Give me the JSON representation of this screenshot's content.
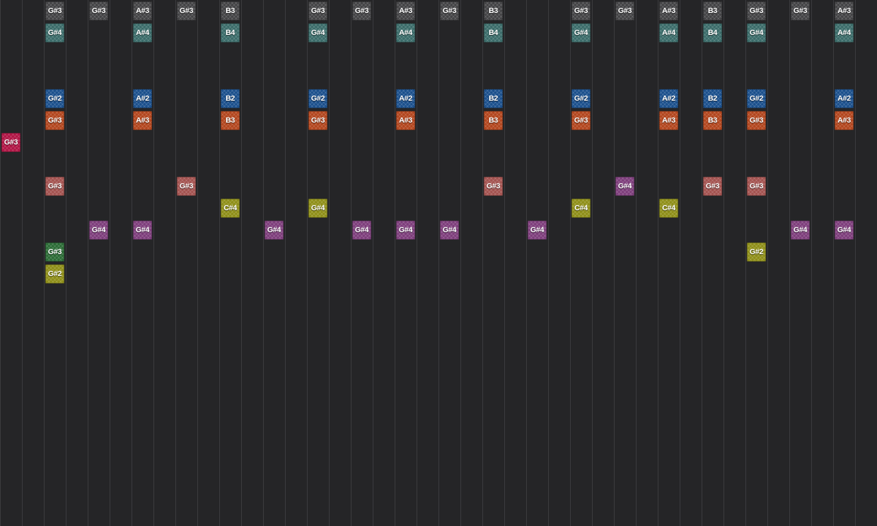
{
  "palette": {
    "background": "#252527",
    "gridline": "#3c3c3f",
    "gray": "#424244",
    "teal": "#3a6b69",
    "blue": "#1a4f8c",
    "orange": "#b2451d",
    "crimson": "#b01444",
    "salmon": "#a3524f",
    "olive": "#8e8e17",
    "purple": "#7d3d7b",
    "green": "#2b6b35",
    "yellow": "#8e8e17"
  },
  "notes": [
    {
      "col": 2,
      "row": 0,
      "label": "G#3",
      "color": "gray"
    },
    {
      "col": 4,
      "row": 0,
      "label": "G#3",
      "color": "gray"
    },
    {
      "col": 6,
      "row": 0,
      "label": "A#3",
      "color": "gray"
    },
    {
      "col": 8,
      "row": 0,
      "label": "G#3",
      "color": "gray"
    },
    {
      "col": 10,
      "row": 0,
      "label": "B3",
      "color": "gray"
    },
    {
      "col": 14,
      "row": 0,
      "label": "G#3",
      "color": "gray"
    },
    {
      "col": 16,
      "row": 0,
      "label": "G#3",
      "color": "gray"
    },
    {
      "col": 18,
      "row": 0,
      "label": "A#3",
      "color": "gray"
    },
    {
      "col": 20,
      "row": 0,
      "label": "G#3",
      "color": "gray"
    },
    {
      "col": 22,
      "row": 0,
      "label": "B3",
      "color": "gray"
    },
    {
      "col": 26,
      "row": 0,
      "label": "G#3",
      "color": "gray"
    },
    {
      "col": 28,
      "row": 0,
      "label": "G#3",
      "color": "gray"
    },
    {
      "col": 30,
      "row": 0,
      "label": "A#3",
      "color": "gray"
    },
    {
      "col": 32,
      "row": 0,
      "label": "B3",
      "color": "gray"
    },
    {
      "col": 34,
      "row": 0,
      "label": "G#3",
      "color": "gray"
    },
    {
      "col": 36,
      "row": 0,
      "label": "G#3",
      "color": "gray"
    },
    {
      "col": 38,
      "row": 0,
      "label": "A#3",
      "color": "gray"
    },
    {
      "col": 2,
      "row": 1,
      "label": "G#4",
      "color": "teal"
    },
    {
      "col": 6,
      "row": 1,
      "label": "A#4",
      "color": "teal"
    },
    {
      "col": 10,
      "row": 1,
      "label": "B4",
      "color": "teal"
    },
    {
      "col": 14,
      "row": 1,
      "label": "G#4",
      "color": "teal"
    },
    {
      "col": 18,
      "row": 1,
      "label": "A#4",
      "color": "teal"
    },
    {
      "col": 22,
      "row": 1,
      "label": "B4",
      "color": "teal"
    },
    {
      "col": 26,
      "row": 1,
      "label": "G#4",
      "color": "teal"
    },
    {
      "col": 30,
      "row": 1,
      "label": "A#4",
      "color": "teal"
    },
    {
      "col": 32,
      "row": 1,
      "label": "B4",
      "color": "teal"
    },
    {
      "col": 34,
      "row": 1,
      "label": "G#4",
      "color": "teal"
    },
    {
      "col": 38,
      "row": 1,
      "label": "A#4",
      "color": "teal"
    },
    {
      "col": 2,
      "row": 4,
      "label": "G#2",
      "color": "blue"
    },
    {
      "col": 6,
      "row": 4,
      "label": "A#2",
      "color": "blue"
    },
    {
      "col": 10,
      "row": 4,
      "label": "B2",
      "color": "blue"
    },
    {
      "col": 14,
      "row": 4,
      "label": "G#2",
      "color": "blue"
    },
    {
      "col": 18,
      "row": 4,
      "label": "A#2",
      "color": "blue"
    },
    {
      "col": 22,
      "row": 4,
      "label": "B2",
      "color": "blue"
    },
    {
      "col": 26,
      "row": 4,
      "label": "G#2",
      "color": "blue"
    },
    {
      "col": 30,
      "row": 4,
      "label": "A#2",
      "color": "blue"
    },
    {
      "col": 32,
      "row": 4,
      "label": "B2",
      "color": "blue"
    },
    {
      "col": 34,
      "row": 4,
      "label": "G#2",
      "color": "blue"
    },
    {
      "col": 38,
      "row": 4,
      "label": "A#2",
      "color": "blue"
    },
    {
      "col": 2,
      "row": 5,
      "label": "G#3",
      "color": "orange"
    },
    {
      "col": 6,
      "row": 5,
      "label": "A#3",
      "color": "orange"
    },
    {
      "col": 10,
      "row": 5,
      "label": "B3",
      "color": "orange"
    },
    {
      "col": 14,
      "row": 5,
      "label": "G#3",
      "color": "orange"
    },
    {
      "col": 18,
      "row": 5,
      "label": "A#3",
      "color": "orange"
    },
    {
      "col": 22,
      "row": 5,
      "label": "B3",
      "color": "orange"
    },
    {
      "col": 26,
      "row": 5,
      "label": "G#3",
      "color": "orange"
    },
    {
      "col": 30,
      "row": 5,
      "label": "A#3",
      "color": "orange"
    },
    {
      "col": 32,
      "row": 5,
      "label": "B3",
      "color": "orange"
    },
    {
      "col": 34,
      "row": 5,
      "label": "G#3",
      "color": "orange"
    },
    {
      "col": 38,
      "row": 5,
      "label": "A#3",
      "color": "orange"
    },
    {
      "col": 0,
      "row": 6,
      "label": "G#3",
      "color": "crimson"
    },
    {
      "col": 2,
      "row": 8,
      "label": "G#3",
      "color": "salmon"
    },
    {
      "col": 8,
      "row": 8,
      "label": "G#3",
      "color": "salmon"
    },
    {
      "col": 22,
      "row": 8,
      "label": "G#3",
      "color": "salmon"
    },
    {
      "col": 28,
      "row": 8,
      "label": "G#4",
      "color": "purple"
    },
    {
      "col": 32,
      "row": 8,
      "label": "G#3",
      "color": "salmon"
    },
    {
      "col": 34,
      "row": 8,
      "label": "G#3",
      "color": "salmon"
    },
    {
      "col": 10,
      "row": 9,
      "label": "C#4",
      "color": "olive"
    },
    {
      "col": 14,
      "row": 9,
      "label": "G#4",
      "color": "olive"
    },
    {
      "col": 26,
      "row": 9,
      "label": "C#4",
      "color": "olive"
    },
    {
      "col": 30,
      "row": 9,
      "label": "C#4",
      "color": "olive"
    },
    {
      "col": 4,
      "row": 10,
      "label": "G#4",
      "color": "purple"
    },
    {
      "col": 6,
      "row": 10,
      "label": "G#4",
      "color": "purple"
    },
    {
      "col": 12,
      "row": 10,
      "label": "G#4",
      "color": "purple"
    },
    {
      "col": 16,
      "row": 10,
      "label": "G#4",
      "color": "purple"
    },
    {
      "col": 18,
      "row": 10,
      "label": "G#4",
      "color": "purple"
    },
    {
      "col": 20,
      "row": 10,
      "label": "G#4",
      "color": "purple"
    },
    {
      "col": 24,
      "row": 10,
      "label": "G#4",
      "color": "purple"
    },
    {
      "col": 36,
      "row": 10,
      "label": "G#4",
      "color": "purple"
    },
    {
      "col": 38,
      "row": 10,
      "label": "G#4",
      "color": "purple"
    },
    {
      "col": 2,
      "row": 11,
      "label": "G#3",
      "color": "green"
    },
    {
      "col": 34,
      "row": 11,
      "label": "G#2",
      "color": "yellow"
    },
    {
      "col": 2,
      "row": 12,
      "label": "G#2",
      "color": "yellow"
    }
  ]
}
